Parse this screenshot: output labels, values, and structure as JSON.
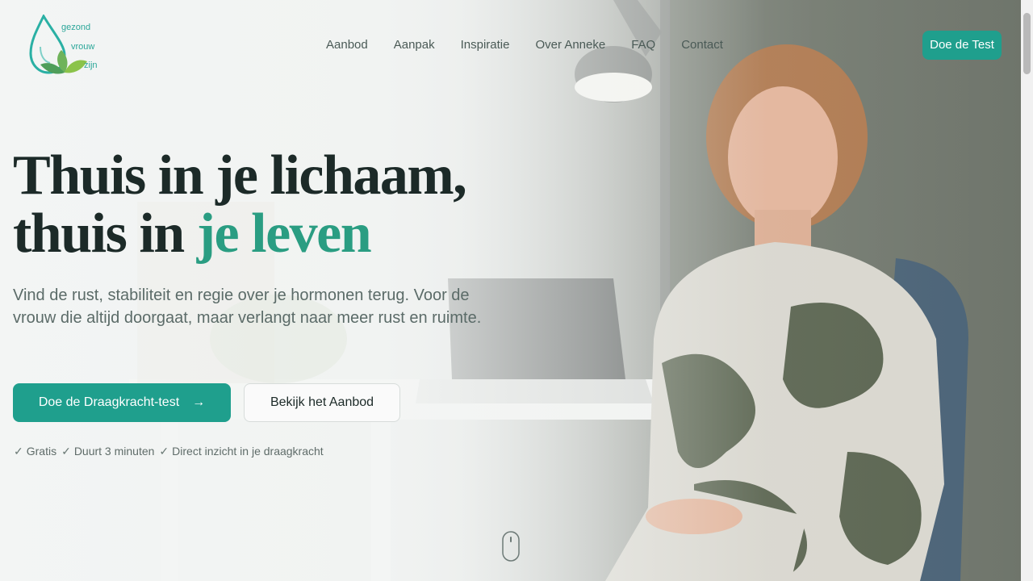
{
  "header": {
    "logo": {
      "line1": "gezond",
      "line2": "vrouw",
      "line3": "zijn"
    },
    "nav": [
      "Aanbod",
      "Aanpak",
      "Inspiratie",
      "Over Anneke",
      "FAQ",
      "Contact"
    ],
    "cta_label": "Doe de Test"
  },
  "hero": {
    "headline_line1": "Thuis in je lichaam,",
    "headline_line2_plain": "thuis in ",
    "headline_line2_accent": "je leven",
    "lead": "Vind de rust, stabiliteit en regie over je hormonen terug. Voor de vrouw die altijd doorgaat, maar verlangt naar meer rust en ruimte.",
    "primary_button": "Doe de Draagkracht-test",
    "primary_button_icon": "arrow-right-icon",
    "secondary_button": "Bekijk het Aanbod",
    "checks": [
      "Gratis",
      "Duurt 3 minuten",
      "Direct inzicht in je draagkracht"
    ],
    "check_symbol": "✓",
    "arrow_symbol": "→"
  },
  "colors": {
    "accent": "#1f9f8d",
    "headline_accent": "#2a9d82",
    "headline": "#1c2a28"
  }
}
